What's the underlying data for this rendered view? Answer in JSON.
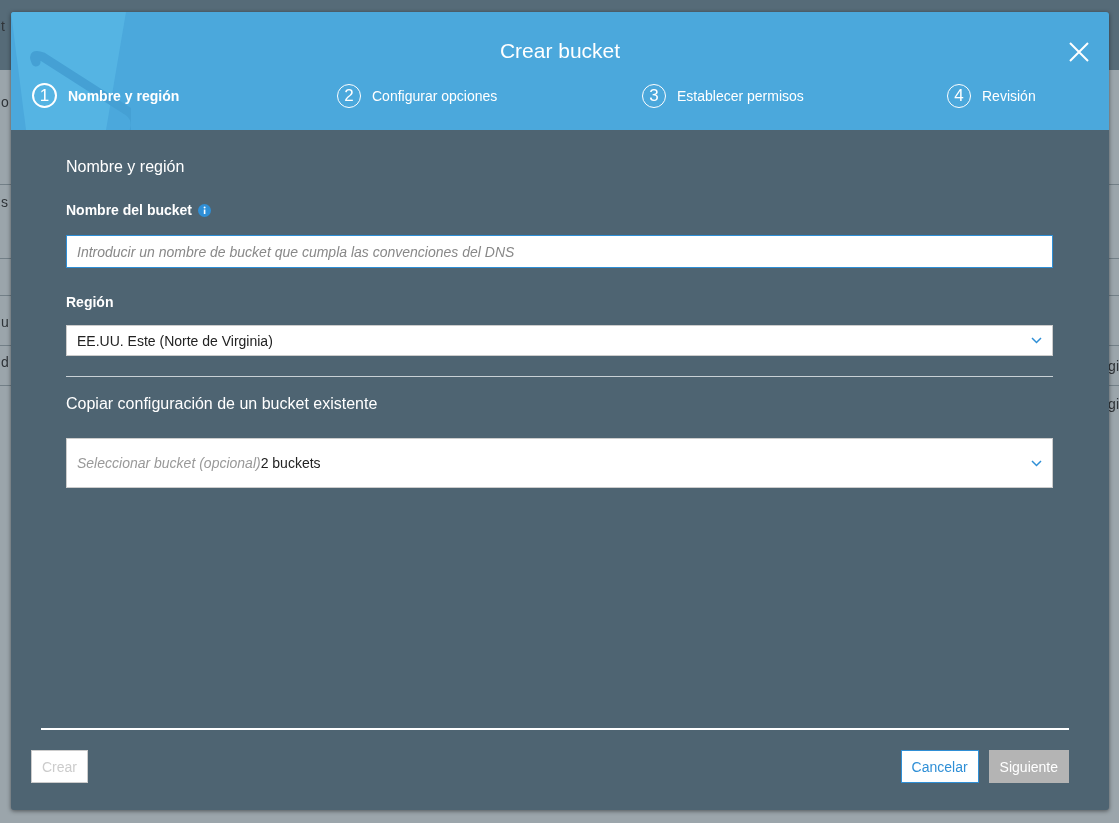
{
  "background_left": [
    "t",
    "o",
    "s",
    "u",
    "d"
  ],
  "background_right": [
    "gi",
    "gi"
  ],
  "dialog": {
    "title": "Crear bucket",
    "steps": [
      {
        "number": "1",
        "label": "Nombre y región",
        "selected": true
      },
      {
        "number": "2",
        "label": "Configurar opciones",
        "selected": false
      },
      {
        "number": "3",
        "label": "Establecer permisos",
        "selected": false
      },
      {
        "number": "4",
        "label": "Revisión",
        "selected": false
      }
    ],
    "section_title": "Nombre y región",
    "bucket_name": {
      "label": "Nombre del bucket",
      "placeholder": "Introducir un nombre de bucket que cumpla las convenciones del DNS"
    },
    "region": {
      "label": "Región",
      "value": "EE.UU. Este (Norte de Virginia)"
    },
    "copy_section_title": "Copiar configuración de un bucket existente",
    "copy_select": {
      "placeholder": "Seleccionar bucket (opcional)",
      "count": "2 buckets"
    },
    "buttons": [
      {
        "label": "Crear",
        "kind": "primary",
        "disabled": true
      },
      {
        "label": "Cancelar",
        "kind": "secondary",
        "disabled": false
      },
      {
        "label": "Siguiente",
        "kind": "next",
        "disabled": true
      }
    ]
  }
}
